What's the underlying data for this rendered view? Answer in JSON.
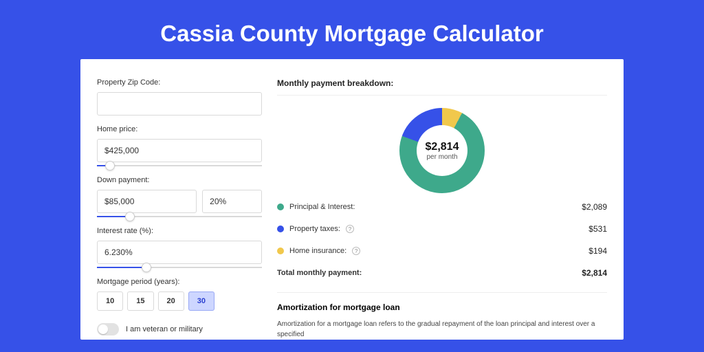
{
  "title": "Cassia County Mortgage Calculator",
  "colors": {
    "principal": "#3ea98b",
    "taxes": "#3651e8",
    "insurance": "#f1c84c"
  },
  "form": {
    "zip_label": "Property Zip Code:",
    "zip_value": "",
    "price_label": "Home price:",
    "price_value": "$425,000",
    "price_slider_pct": 8,
    "down_label": "Down payment:",
    "down_value": "$85,000",
    "down_pct": "20%",
    "down_slider_pct": 20,
    "rate_label": "Interest rate (%):",
    "rate_value": "6.230%",
    "rate_slider_pct": 30,
    "period_label": "Mortgage period (years):",
    "periods": [
      "10",
      "15",
      "20",
      "30"
    ],
    "period_active": "30",
    "vet_label": "I am veteran or military"
  },
  "breakdown": {
    "title": "Monthly payment breakdown:",
    "center_value": "$2,814",
    "center_sub": "per month",
    "items": [
      {
        "label": "Principal & Interest:",
        "amount": "$2,089",
        "color": "principal",
        "tip": false
      },
      {
        "label": "Property taxes:",
        "amount": "$531",
        "color": "taxes",
        "tip": true
      },
      {
        "label": "Home insurance:",
        "amount": "$194",
        "color": "insurance",
        "tip": true
      }
    ],
    "total_label": "Total monthly payment:",
    "total_value": "$2,814"
  },
  "chart_data": {
    "type": "pie",
    "title": "Monthly payment breakdown",
    "categories": [
      "Principal & Interest",
      "Property taxes",
      "Home insurance"
    ],
    "values": [
      2089,
      531,
      194
    ],
    "total": 2814,
    "unit": "USD/month",
    "colors": [
      "#3ea98b",
      "#3651e8",
      "#f1c84c"
    ]
  },
  "amort": {
    "title": "Amortization for mortgage loan",
    "text": "Amortization for a mortgage loan refers to the gradual repayment of the loan principal and interest over a specified"
  }
}
